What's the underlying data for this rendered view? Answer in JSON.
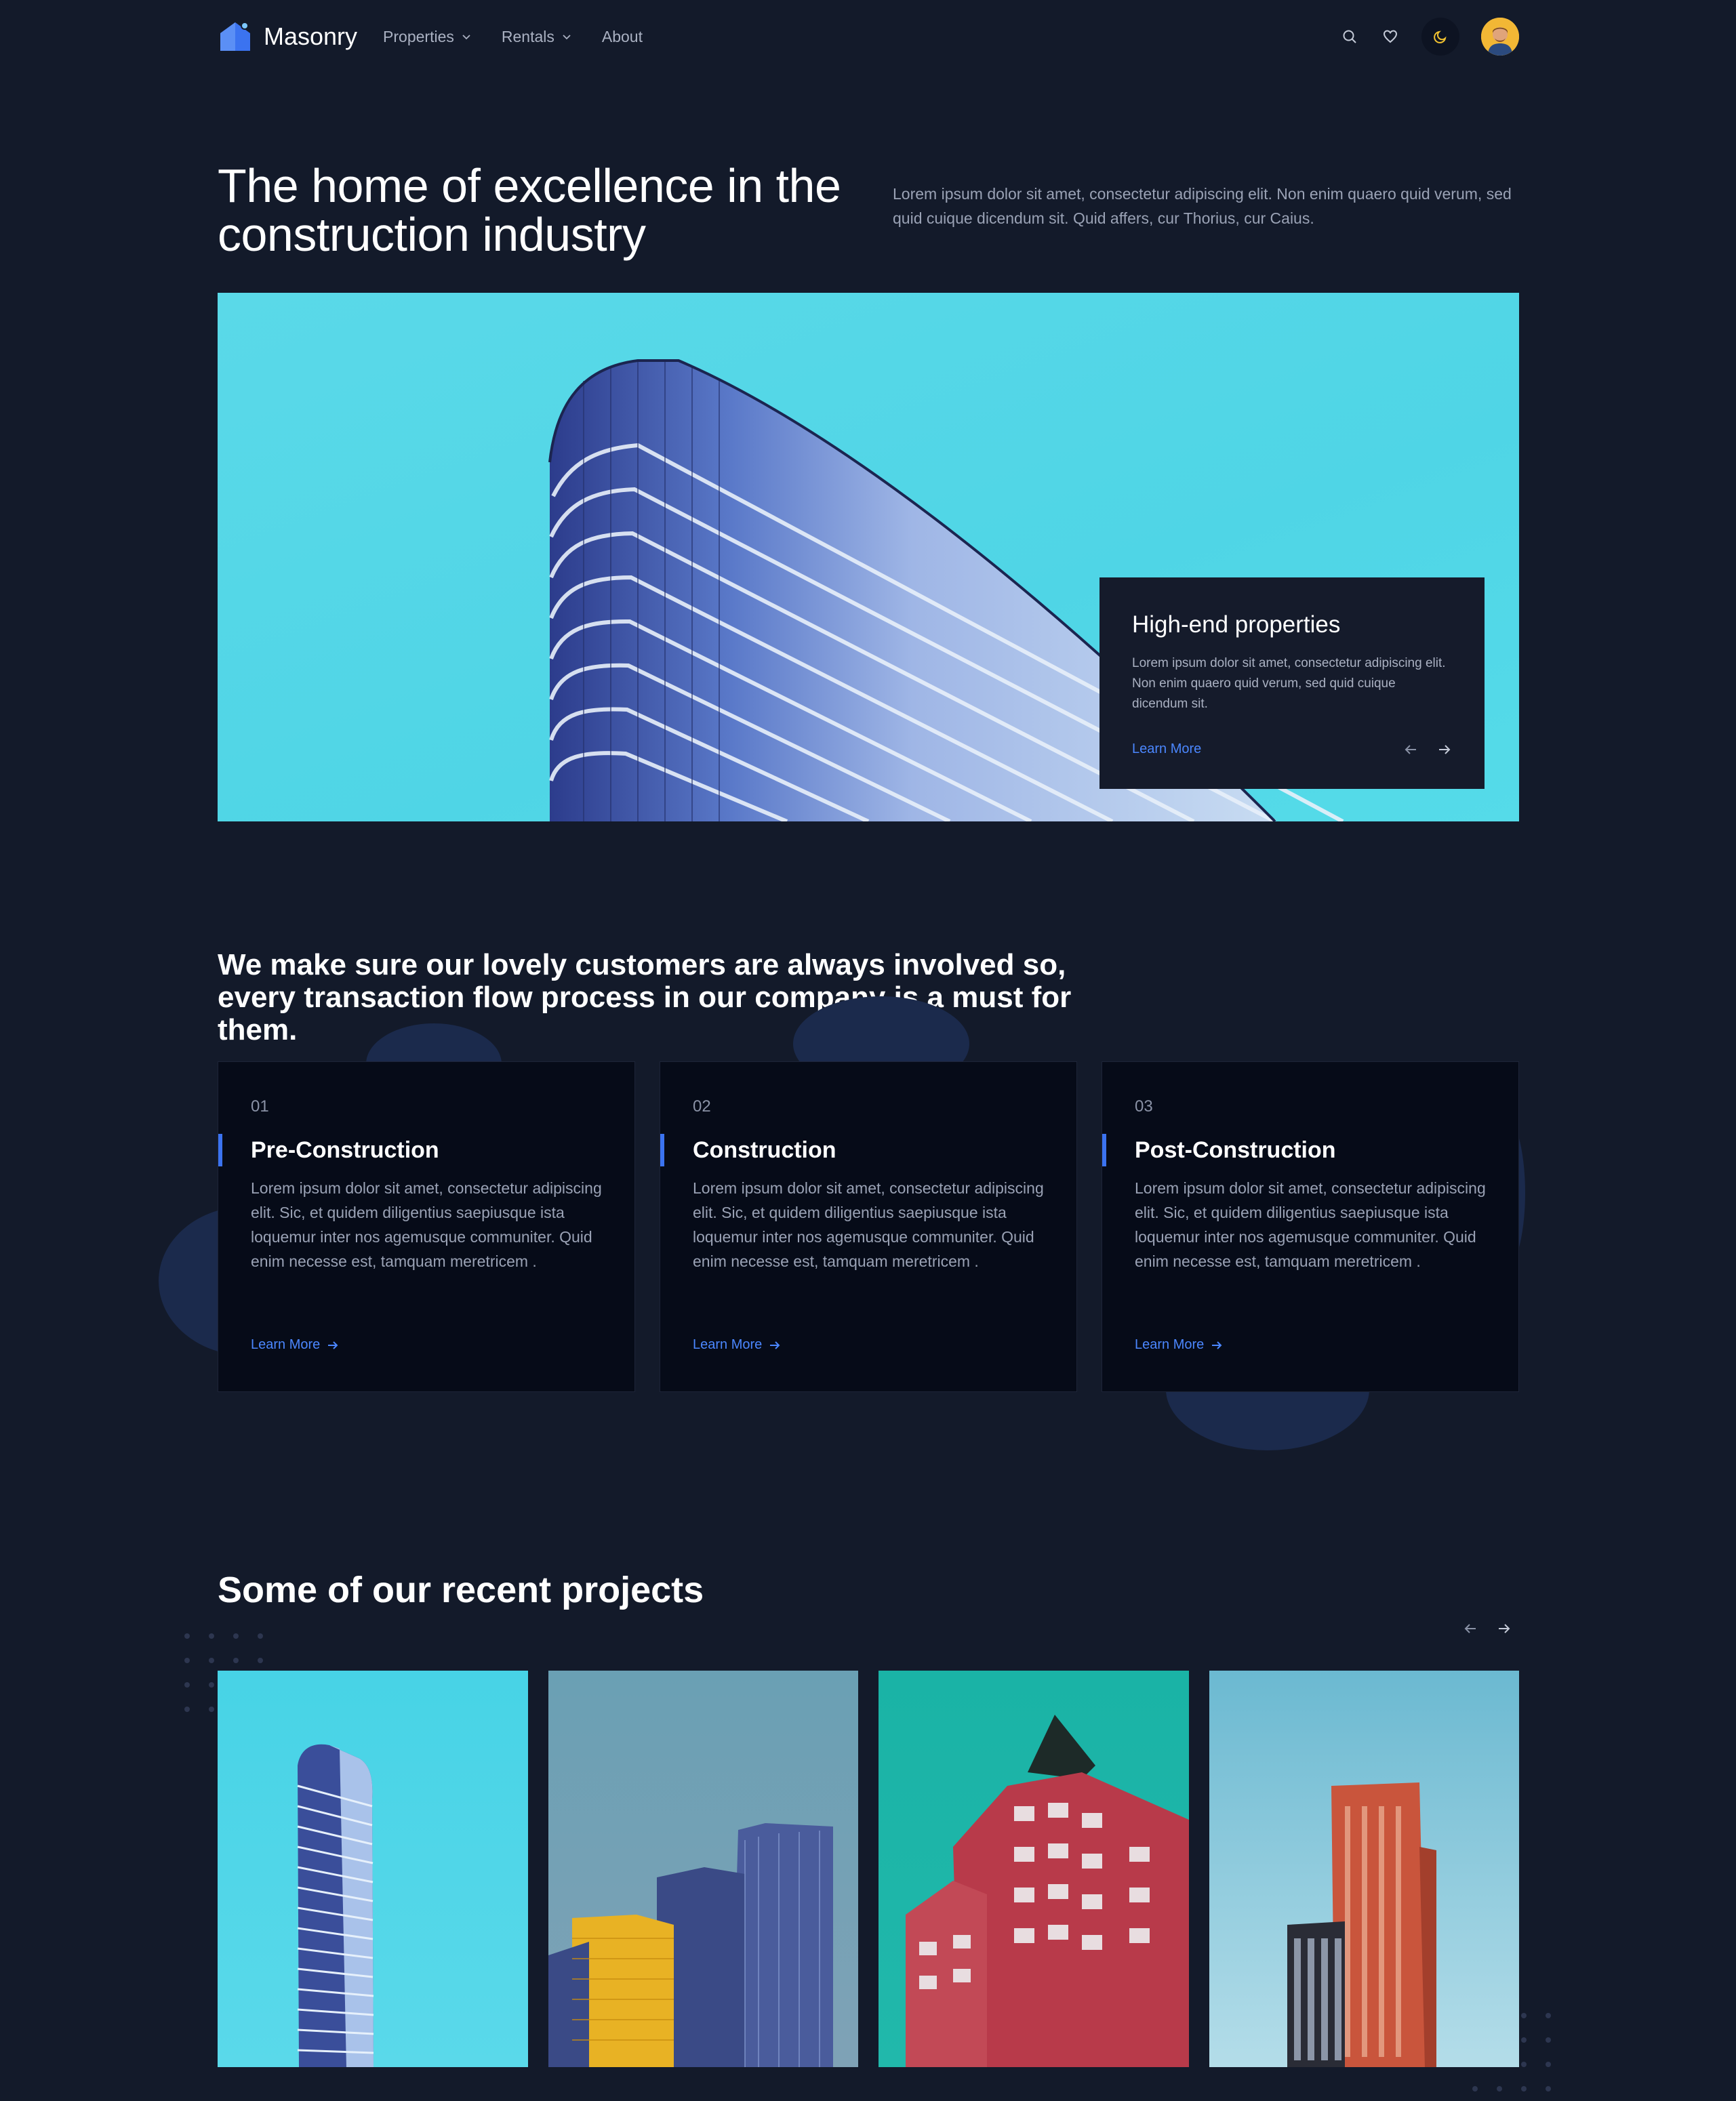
{
  "nav": {
    "brand": "Masonry",
    "items": [
      {
        "label": "Properties",
        "has_dropdown": true
      },
      {
        "label": "Rentals",
        "has_dropdown": true
      },
      {
        "label": "About",
        "has_dropdown": false
      }
    ],
    "icons": [
      "search-icon",
      "heart-icon",
      "moon-icon",
      "avatar"
    ]
  },
  "hero": {
    "title": "The home of excellence in the construction industry",
    "description": "Lorem ipsum dolor sit amet, consectetur adipiscing elit. Non enim quaero quid verum, sed quid cuique dicendum sit. Quid affers, cur Thorius, cur Caius.",
    "card": {
      "title": "High-end properties",
      "text": "Lorem ipsum dolor sit amet, consectetur adipiscing elit. Non enim quaero quid verum, sed quid cuique dicendum sit.",
      "link": "Learn More"
    }
  },
  "process": {
    "title": "We make sure our lovely customers are always involved so, every transaction flow process in our company is a must for them.",
    "steps": [
      {
        "number": "01",
        "title": "Pre-Construction",
        "text": "Lorem ipsum dolor sit amet, consectetur adipiscing elit. Sic, et quidem diligentius saepiusque ista loquemur inter nos agemusque communiter. Quid enim necesse est, tamquam meretricem .",
        "link": "Learn More"
      },
      {
        "number": "02",
        "title": "Construction",
        "text": "Lorem ipsum dolor sit amet, consectetur adipiscing elit. Sic, et quidem diligentius saepiusque ista loquemur inter nos agemusque communiter. Quid enim necesse est, tamquam meretricem .",
        "link": "Learn More"
      },
      {
        "number": "03",
        "title": "Post-Construction",
        "text": "Lorem ipsum dolor sit amet, consectetur adipiscing elit. Sic, et quidem diligentius saepiusque ista loquemur inter nos agemusque communiter. Quid enim necesse est, tamquam meretricem .",
        "link": "Learn More"
      }
    ]
  },
  "projects": {
    "title": "Some of our recent projects"
  },
  "colors": {
    "background": "#131a2a",
    "accent": "#3b73f0",
    "link": "#4b87ff",
    "card": "#060b18",
    "sky": "#4fd5e6"
  }
}
